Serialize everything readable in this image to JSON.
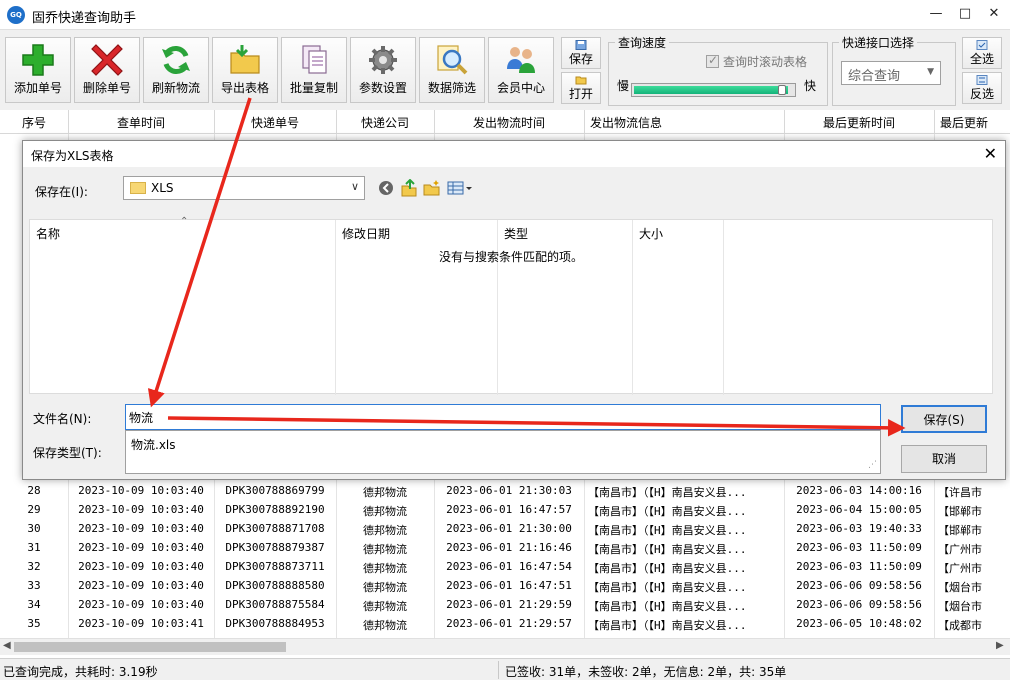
{
  "window": {
    "title": "固乔快递查询助手",
    "app_icon_text": "GQ"
  },
  "toolbar": {
    "buttons": [
      {
        "label": "添加单号"
      },
      {
        "label": "删除单号"
      },
      {
        "label": "刷新物流"
      },
      {
        "label": "导出表格"
      },
      {
        "label": "批量复制"
      },
      {
        "label": "参数设置"
      },
      {
        "label": "数据筛选"
      },
      {
        "label": "会员中心"
      }
    ],
    "save_label": "保存",
    "open_label": "打开",
    "speed_group": {
      "title": "查询速度",
      "scroll_checkbox": "查询时滚动表格",
      "slow": "慢",
      "fast": "快",
      "speed_level": 0.97
    },
    "interface_group": {
      "title": "快递接口选择",
      "selected": "综合查询"
    },
    "select_all": "全选",
    "invert": "反选"
  },
  "table": {
    "columns": [
      "序号",
      "查单时间",
      "快递单号",
      "快递公司",
      "发出物流时间",
      "发出物流信息",
      "最后更新时间",
      "最后更新"
    ],
    "rows": [
      [
        "28",
        "2023-10-09 10:03:40",
        "DPK300788869799",
        "德邦物流",
        "2023-06-01 21:30:03",
        "【南昌市】（【H】南昌安义县...",
        "2023-06-03 14:00:16",
        "【许昌市"
      ],
      [
        "29",
        "2023-10-09 10:03:40",
        "DPK300788892190",
        "德邦物流",
        "2023-06-01 16:47:57",
        "【南昌市】（【H】南昌安义县...",
        "2023-06-04 15:00:05",
        "【邯郸市"
      ],
      [
        "30",
        "2023-10-09 10:03:40",
        "DPK300788871708",
        "德邦物流",
        "2023-06-01 21:30:00",
        "【南昌市】（【H】南昌安义县...",
        "2023-06-03 19:40:33",
        "【邯郸市"
      ],
      [
        "31",
        "2023-10-09 10:03:40",
        "DPK300788879387",
        "德邦物流",
        "2023-06-01 21:16:46",
        "【南昌市】（【H】南昌安义县...",
        "2023-06-03 11:50:09",
        "【广州市"
      ],
      [
        "32",
        "2023-10-09 10:03:40",
        "DPK300788873711",
        "德邦物流",
        "2023-06-01 16:47:54",
        "【南昌市】（【H】南昌安义县...",
        "2023-06-03 11:50:09",
        "【广州市"
      ],
      [
        "33",
        "2023-10-09 10:03:40",
        "DPK300788888580",
        "德邦物流",
        "2023-06-01 16:47:51",
        "【南昌市】（【H】南昌安义县...",
        "2023-06-06 09:58:56",
        "【烟台市"
      ],
      [
        "34",
        "2023-10-09 10:03:40",
        "DPK300788875584",
        "德邦物流",
        "2023-06-01 21:29:59",
        "【南昌市】（【H】南昌安义县...",
        "2023-06-06 09:58:56",
        "【烟台市"
      ],
      [
        "35",
        "2023-10-09 10:03:41",
        "DPK300788884953",
        "德邦物流",
        "2023-06-01 21:29:57",
        "【南昌市】（【H】南昌安义县...",
        "2023-06-05 10:48:02",
        "【成都市"
      ]
    ]
  },
  "status": {
    "left": "已查询完成，共耗时: 3.19秒",
    "right": "已签收: 31单，未签收: 2单，无信息: 2单，共: 35单"
  },
  "dialog": {
    "title": "保存为XLS表格",
    "save_in_label": "保存在(I):",
    "folder": "XLS",
    "columns": [
      "名称",
      "修改日期",
      "类型",
      "大小"
    ],
    "empty_message": "没有与搜索条件匹配的项。",
    "filename_label": "文件名(N):",
    "filename_value": "物流",
    "filetype_label": "保存类型(T):",
    "suggestion": "物流.xls",
    "save_button": "保存(S)",
    "cancel_button": "取消"
  },
  "colors": {
    "annotation_arrow": "#e8271c",
    "focus_blue": "#2f7bd6",
    "speed_fill": "#14b37a"
  }
}
